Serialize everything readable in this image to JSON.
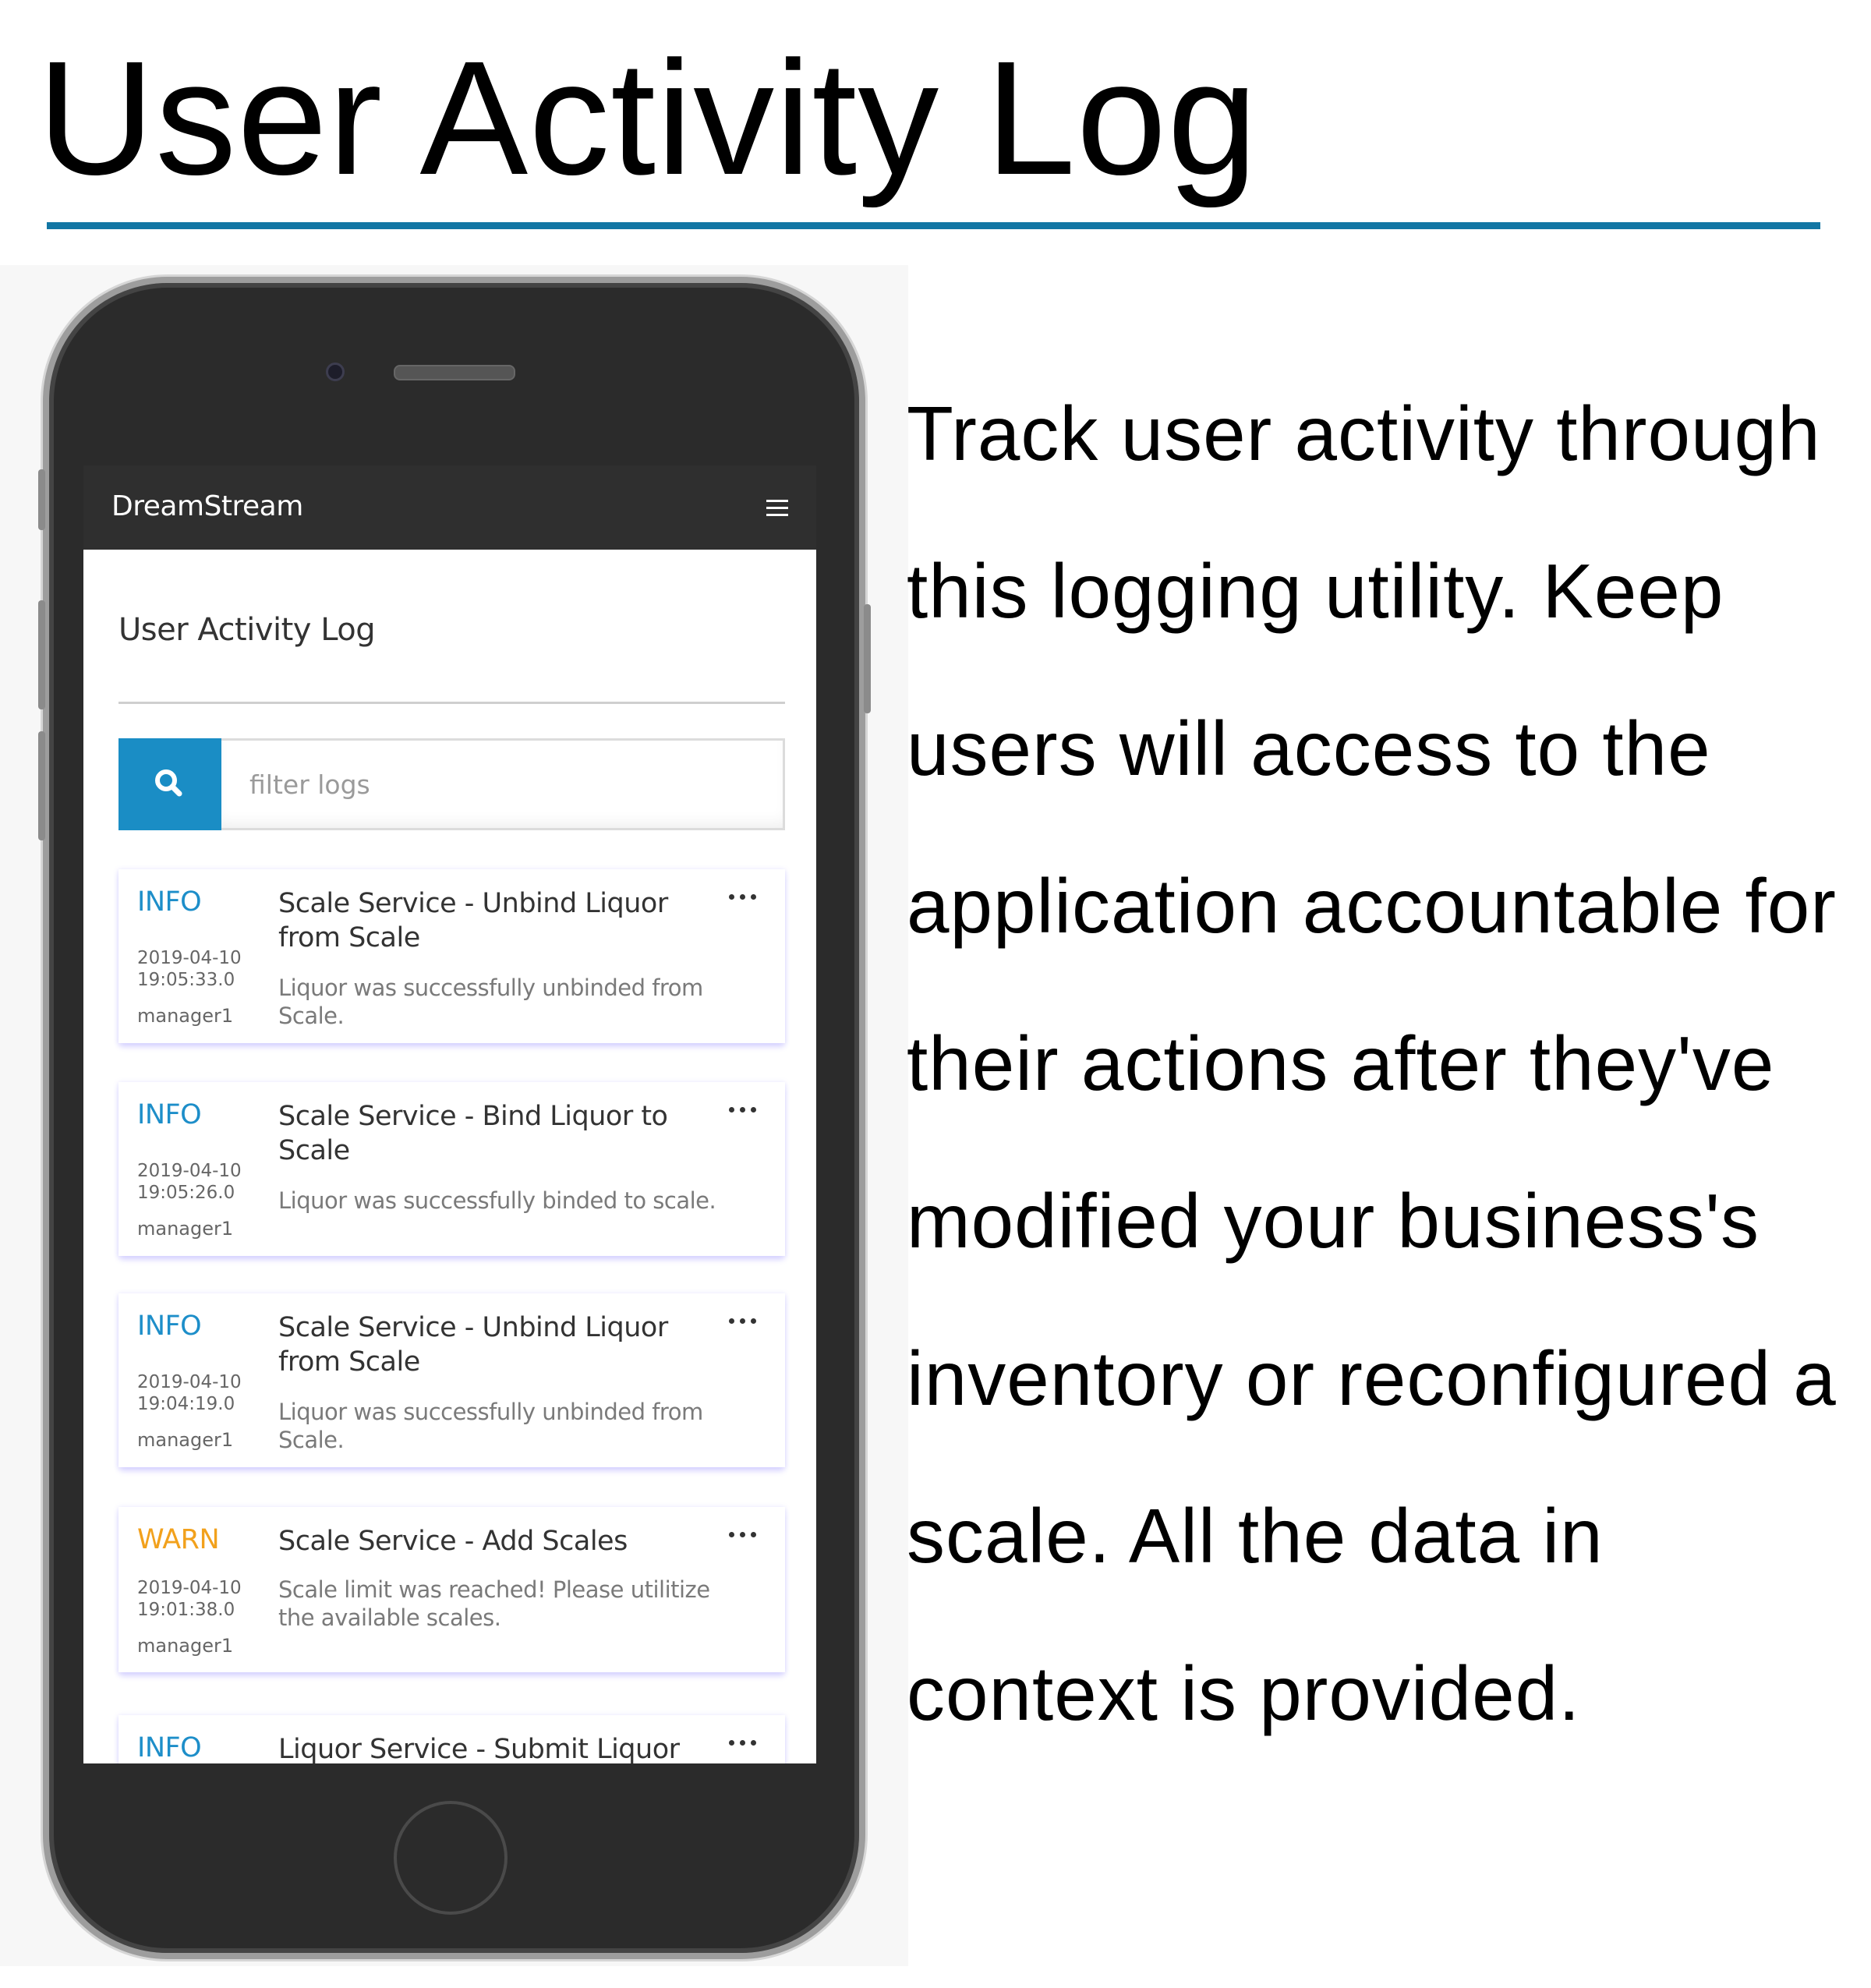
{
  "page": {
    "title": "User Activity Log",
    "description": "Track user activity through this logging utility. Keep users will access to the application accountable for their actions after they've modified your business's inventory or reconfigured a scale. All the data in context is provided.",
    "accent_color": "#1276a4"
  },
  "app": {
    "brand": "DreamStream",
    "menu_icon": "hamburger-menu-icon",
    "heading": "User Activity Log",
    "search": {
      "icon": "search-icon",
      "placeholder": "filter logs",
      "value": ""
    },
    "logs": [
      {
        "level": "INFO",
        "timestamp": "2019-04-10 19:05:33.0",
        "user": "manager1",
        "title": "Scale Service - Unbind Liquor from Scale",
        "message": "Liquor was successfully unbinded from Scale."
      },
      {
        "level": "INFO",
        "timestamp": "2019-04-10 19:05:26.0",
        "user": "manager1",
        "title": "Scale Service - Bind Liquor to Scale",
        "message": "Liquor was successfully binded to scale."
      },
      {
        "level": "INFO",
        "timestamp": "2019-04-10 19:04:19.0",
        "user": "manager1",
        "title": "Scale Service - Unbind Liquor from Scale",
        "message": "Liquor was successfully unbinded from Scale."
      },
      {
        "level": "WARN",
        "timestamp": "2019-04-10 19:01:38.0",
        "user": "manager1",
        "title": "Scale Service - Add Scales",
        "message": "Scale limit was reached! Please utilitize the available scales."
      },
      {
        "level": "INFO",
        "title": "Liquor Service - Submit Liquor"
      }
    ],
    "colors": {
      "info": "#1d8ec9",
      "warn": "#f2a11c",
      "navbar": "#2f2f2f",
      "search_button": "#1a8dc5"
    }
  }
}
